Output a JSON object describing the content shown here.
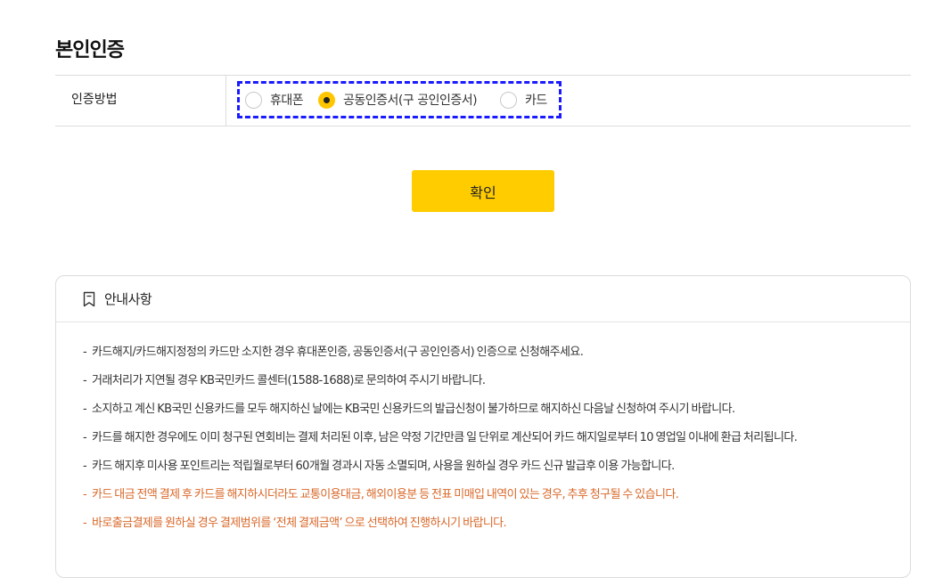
{
  "page": {
    "title": "본인인증"
  },
  "auth": {
    "label": "인증방법",
    "options": [
      {
        "label": "휴대폰",
        "checked": false
      },
      {
        "label": "공동인증서(구 공인인증서)",
        "checked": true
      },
      {
        "label": "카드",
        "checked": false
      }
    ]
  },
  "confirm": {
    "label": "확인"
  },
  "notice": {
    "title": "안내사항",
    "icon": "bookmark-icon",
    "items": [
      "카드해지/카드해지정정의 카드만 소지한 경우 휴대폰인증, 공동인증서(구 공인인증서) 인증으로 신청해주세요.",
      "거래처리가 지연될 경우 KB국민카드 콜센터(1588-1688)로 문의하여 주시기 바랍니다.",
      "소지하고 계신 KB국민 신용카드를 모두 해지하신 날에는 KB국민 신용카드의 발급신청이 불가하므로 해지하신 다음날 신청하여 주시기 바랍니다.",
      "카드를 해지한 경우에도 이미 청구된 연회비는 결제 처리된 이후, 남은 약정 기간만큼 일 단위로 계산되어 카드 해지일로부터 10 영업일 이내에 환급 처리됩니다.",
      "카드 해지후 미사용 포인트리는 적립월로부터 60개월 경과시 자동 소멸되며, 사용을 원하실 경우 카드 신규 발급후 이용 가능합니다.",
      "카드 대금 전액 결제 후 카드를 해지하시더라도 교통이용대금, 해외이용분 등 전표 미매입 내역이 있는 경우, 추후 청구될 수 있습니다.",
      "바로출금결제를 원하실 경우 결제범위를 ‘전체 결제금액’ 으로 선택하여 진행하시기 바랍니다."
    ]
  },
  "colors": {
    "accent": "#ffcc00",
    "warning_text": "#d9682a",
    "highlight_border": "#1a1aff"
  }
}
